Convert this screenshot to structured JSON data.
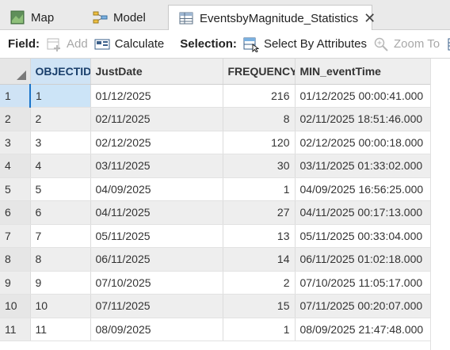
{
  "tabs": [
    {
      "label": "Map",
      "icon": "map-icon"
    },
    {
      "label": "Model",
      "icon": "model-icon"
    },
    {
      "label": "EventsbyMagnitude_Statistics",
      "icon": "table-icon",
      "active": true
    }
  ],
  "toolbar": {
    "field_label": "Field:",
    "add_label": "Add",
    "calculate_label": "Calculate",
    "selection_label": "Selection:",
    "select_by_attributes_label": "Select By Attributes",
    "zoom_to_label": "Zoom To"
  },
  "table": {
    "columns": [
      "OBJECTID",
      "JustDate",
      "FREQUENCY",
      "MIN_eventTime"
    ],
    "rows": [
      {
        "rownum": "1",
        "objectid": "1",
        "justdate": "01/12/2025",
        "frequency": "216",
        "min_eventtime": "01/12/2025 00:00:41.000"
      },
      {
        "rownum": "2",
        "objectid": "2",
        "justdate": "02/11/2025",
        "frequency": "8",
        "min_eventtime": "02/11/2025 18:51:46.000"
      },
      {
        "rownum": "3",
        "objectid": "3",
        "justdate": "02/12/2025",
        "frequency": "120",
        "min_eventtime": "02/12/2025 00:00:18.000"
      },
      {
        "rownum": "4",
        "objectid": "4",
        "justdate": "03/11/2025",
        "frequency": "30",
        "min_eventtime": "03/11/2025 01:33:02.000"
      },
      {
        "rownum": "5",
        "objectid": "5",
        "justdate": "04/09/2025",
        "frequency": "1",
        "min_eventtime": "04/09/2025 16:56:25.000"
      },
      {
        "rownum": "6",
        "objectid": "6",
        "justdate": "04/11/2025",
        "frequency": "27",
        "min_eventtime": "04/11/2025 00:17:13.000"
      },
      {
        "rownum": "7",
        "objectid": "7",
        "justdate": "05/11/2025",
        "frequency": "13",
        "min_eventtime": "05/11/2025 00:33:04.000"
      },
      {
        "rownum": "8",
        "objectid": "8",
        "justdate": "06/11/2025",
        "frequency": "14",
        "min_eventtime": "06/11/2025 01:02:18.000"
      },
      {
        "rownum": "9",
        "objectid": "9",
        "justdate": "07/10/2025",
        "frequency": "2",
        "min_eventtime": "07/10/2025 11:05:17.000"
      },
      {
        "rownum": "10",
        "objectid": "10",
        "justdate": "07/11/2025",
        "frequency": "15",
        "min_eventtime": "07/11/2025 00:20:07.000"
      },
      {
        "rownum": "11",
        "objectid": "11",
        "justdate": "08/09/2025",
        "frequency": "1",
        "min_eventtime": "08/09/2025 21:47:48.000"
      }
    ]
  },
  "colors": {
    "selected_row": "#cce4f7",
    "accent": "#1a73c8"
  }
}
